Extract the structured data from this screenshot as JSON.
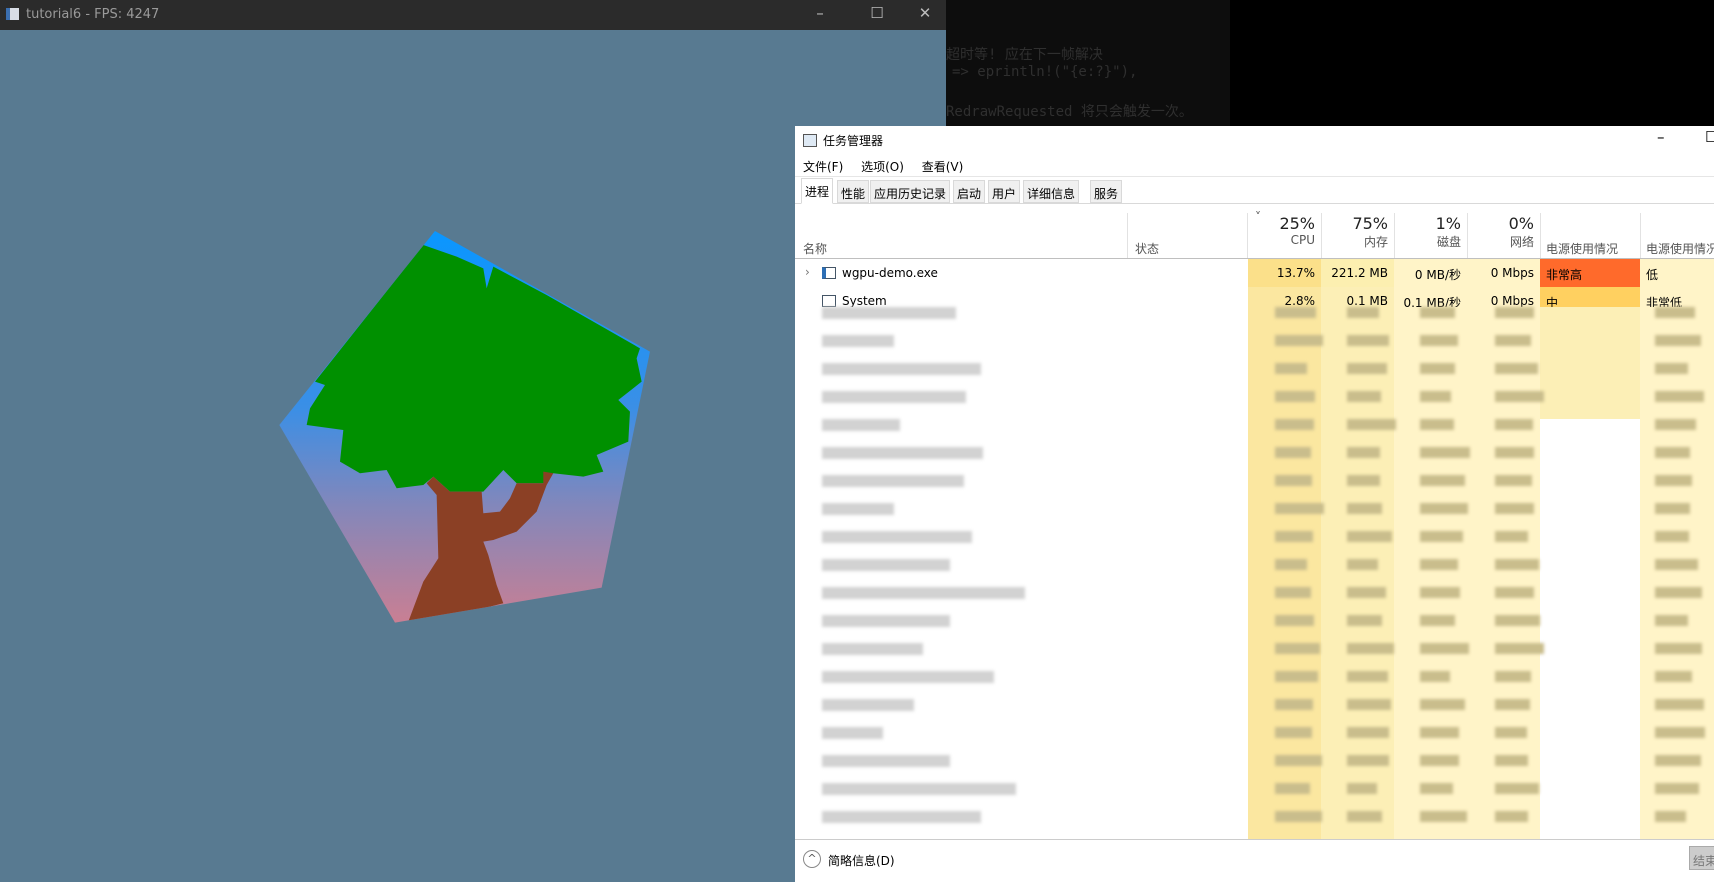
{
  "game_window": {
    "title": "tutorial6 - FPS: 4247",
    "icon": "app-window-icon",
    "bg_color": "#587a91",
    "controls": {
      "minimize": "–",
      "maximize": "☐",
      "close": "✕"
    },
    "scene": {
      "shape": "pentagon",
      "canopy_color": "#009000",
      "trunk_color": "#8b4025",
      "sky_top": "#0a96ff",
      "sky_bottom": "#c97f93"
    }
  },
  "editor": {
    "lines": [
      "超时等! 应在下一帧解决",
      "=> eprintln!(\"{e:?}\"),",
      "RedrawRequested 将只会触发一次。"
    ]
  },
  "task_manager": {
    "title": "任务管理器",
    "controls": {
      "minimize": "–",
      "maximize": "☐"
    },
    "menu": [
      "文件(F)",
      "选项(O)",
      "查看(V)"
    ],
    "tabs": [
      "进程",
      "性能",
      "应用历史记录",
      "启动",
      "用户",
      "详细信息",
      "服务"
    ],
    "active_tab": "进程",
    "columns": {
      "name": "名称",
      "status": "状态",
      "cpu": {
        "pct": "25%",
        "label": "CPU"
      },
      "memory": {
        "pct": "75%",
        "label": "内存"
      },
      "disk": {
        "pct": "1%",
        "label": "磁盘"
      },
      "network": {
        "pct": "0%",
        "label": "网络"
      },
      "power": "电源使用情况",
      "power_trend": "电源使用情况"
    },
    "sort_indicator": "˅",
    "rows": [
      {
        "name": "wgpu-demo.exe",
        "cpu": "13.7%",
        "memory": "221.2 MB",
        "disk": "0 MB/秒",
        "network": "0 Mbps",
        "power": "非常高",
        "power_trend": "低",
        "power_color": "#ff6a2b"
      },
      {
        "name": "System",
        "cpu": "2.8%",
        "memory": "0.1 MB",
        "disk": "0.1 MB/秒",
        "network": "0 Mbps",
        "power": "中",
        "power_trend": "非常低",
        "power_color": "#ffd060"
      }
    ],
    "footer": {
      "fewer_details": "简略信息(D)",
      "end_task": "结束"
    }
  }
}
